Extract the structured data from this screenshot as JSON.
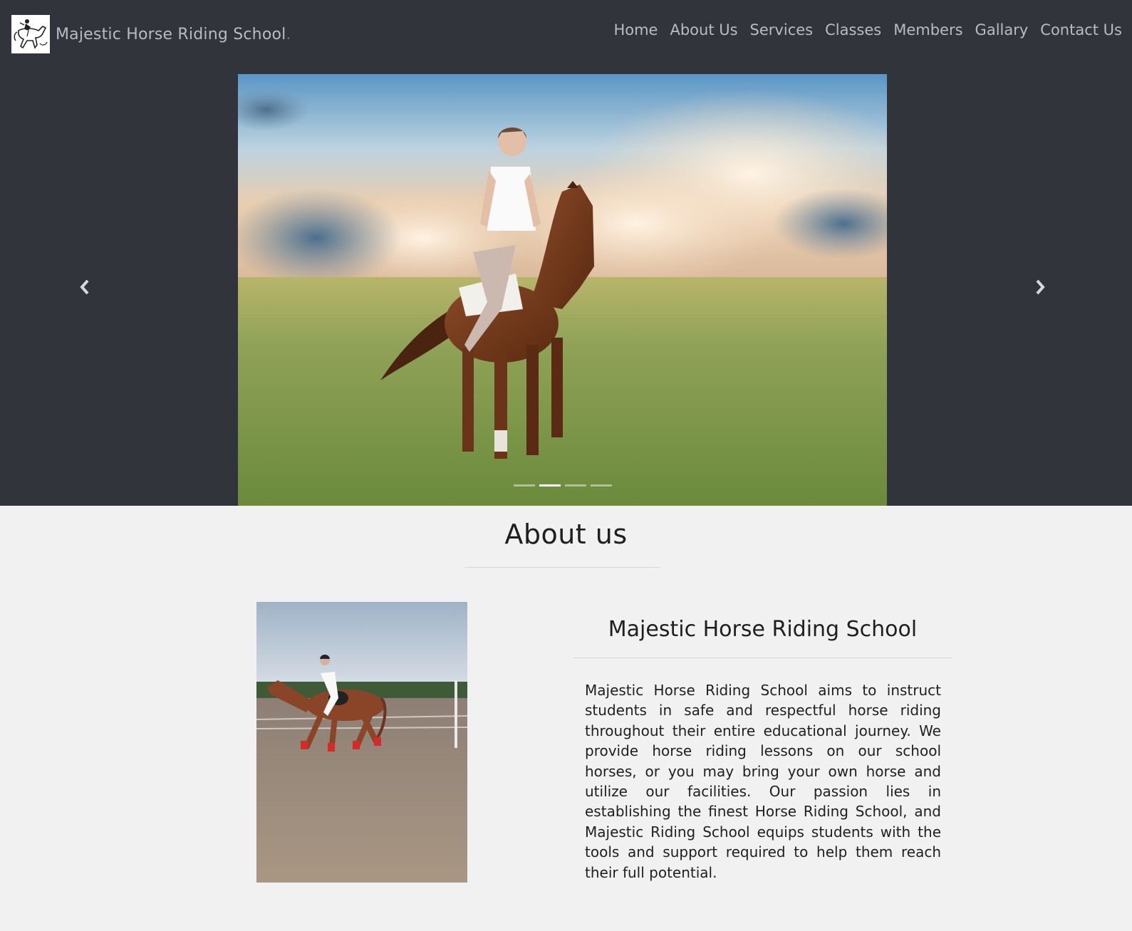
{
  "brand": {
    "name": "Majestic Horse Riding School",
    "dot": ".",
    "logo_icon": "horse-rider-logo-icon"
  },
  "nav": {
    "items": [
      {
        "label": "Home"
      },
      {
        "label": "About Us"
      },
      {
        "label": "Services"
      },
      {
        "label": "Classes"
      },
      {
        "label": "Members"
      },
      {
        "label": "Gallary"
      },
      {
        "label": "Contact Us"
      }
    ]
  },
  "carousel": {
    "prev_icon": "chevron-left-icon",
    "next_icon": "chevron-right-icon",
    "slide_count": 4,
    "active_index": 1
  },
  "about": {
    "title": "About us",
    "heading": "Majestic Horse Riding School",
    "text": "Majestic Horse Riding School aims to instruct students in safe and respectful horse riding throughout their entire educational journey. We provide horse riding lessons on our school horses, or you may bring your own horse and utilize our facilities. Our passion lies in establishing the finest Horse Riding School, and Majestic Riding School equips students with the tools and support required to help them reach their full potential."
  },
  "colors": {
    "header_bg": "#31343b",
    "nav_text": "#b8bcc2",
    "page_bg": "#f1f1f1",
    "text": "#1f1f1f"
  }
}
